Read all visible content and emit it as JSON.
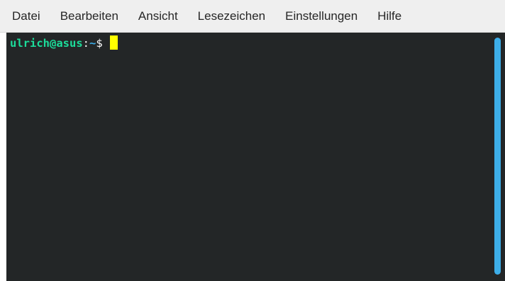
{
  "menubar": {
    "items": [
      {
        "label": "Datei"
      },
      {
        "label": "Bearbeiten"
      },
      {
        "label": "Ansicht"
      },
      {
        "label": "Lesezeichen"
      },
      {
        "label": "Einstellungen"
      },
      {
        "label": "Hilfe"
      }
    ]
  },
  "terminal": {
    "prompt": {
      "user_host": "ulrich@asus",
      "separator": ":",
      "path": "~",
      "symbol": "$"
    },
    "colors": {
      "background": "#232627",
      "user_host": "#1cdc9a",
      "path": "#3daee9",
      "cursor": "#ffff00",
      "scrollbar": "#3daee9"
    }
  }
}
